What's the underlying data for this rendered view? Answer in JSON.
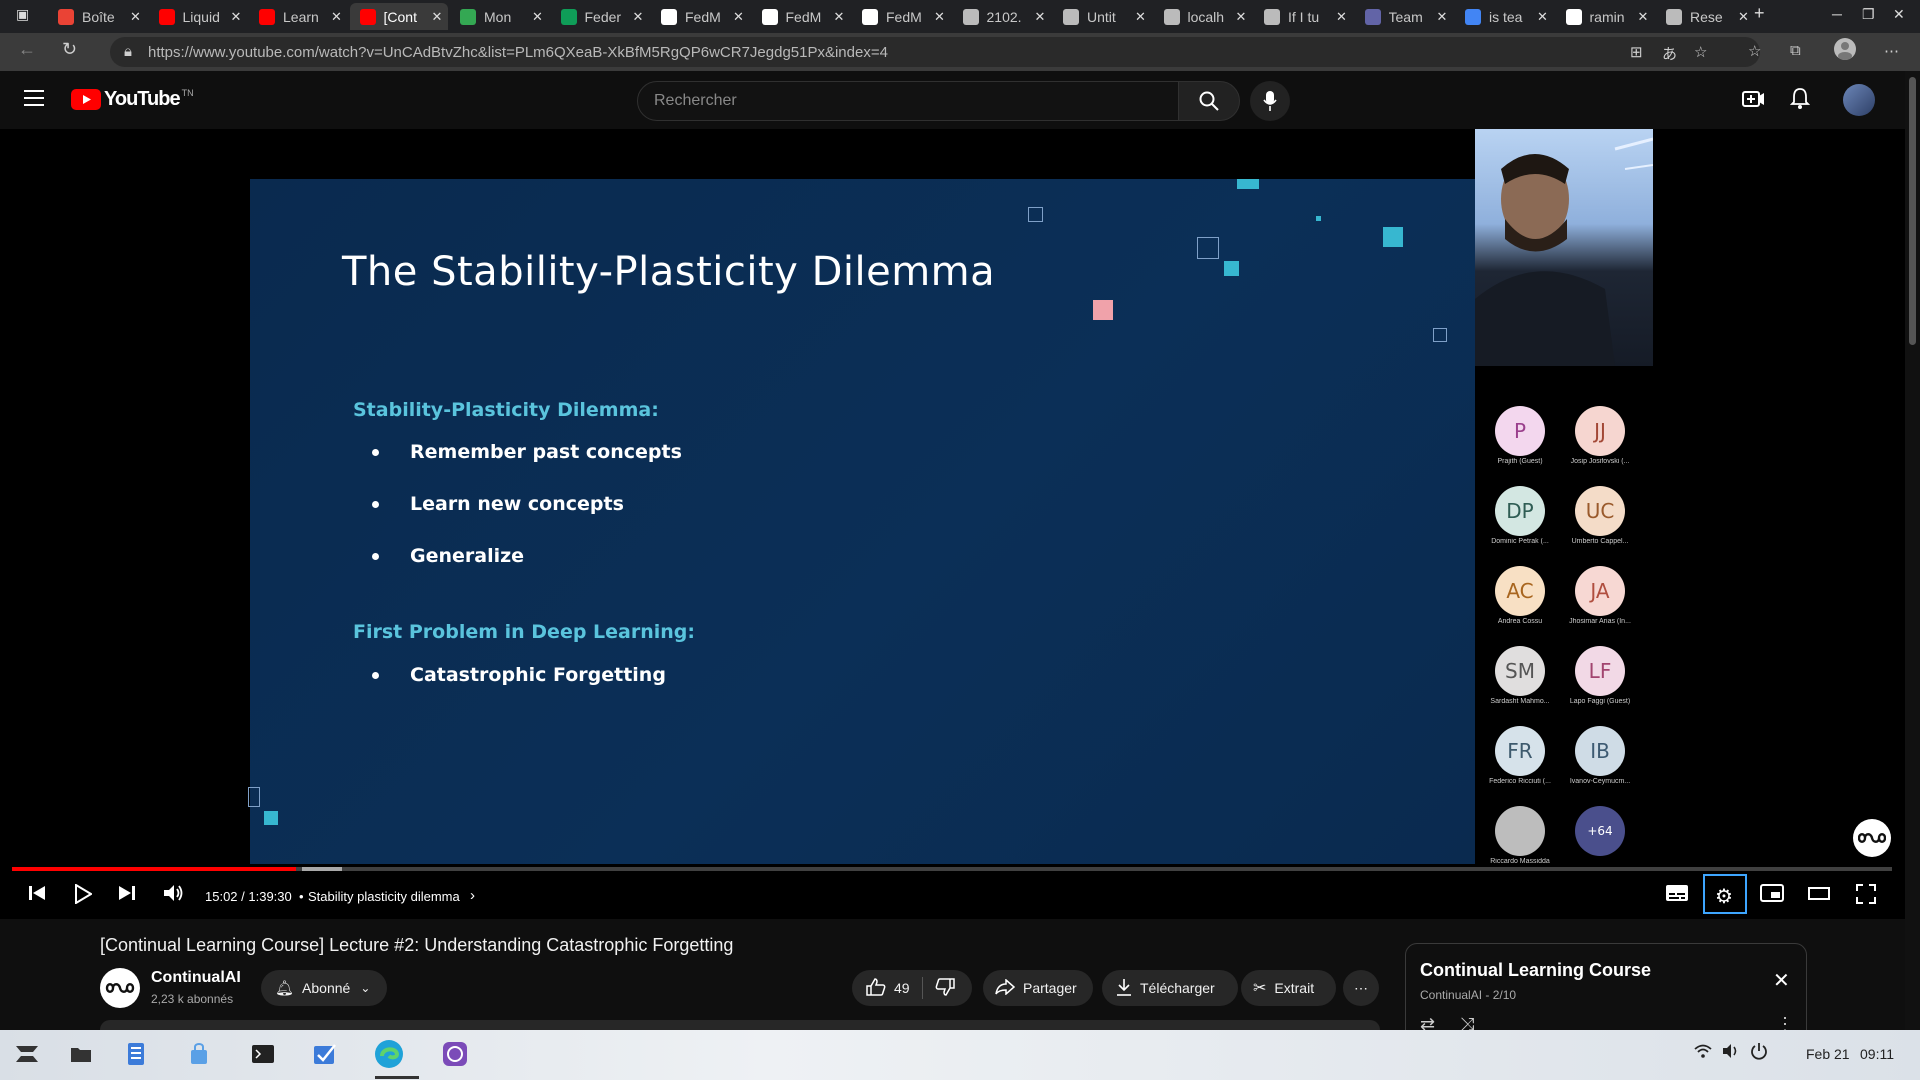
{
  "browser": {
    "tabs": [
      {
        "label": "Boîte",
        "icon": "gmail-icon",
        "color": "#ea4335"
      },
      {
        "label": "Liquid",
        "icon": "youtube-icon",
        "color": "#ff0000"
      },
      {
        "label": "Learn",
        "icon": "youtube-icon",
        "color": "#ff0000"
      },
      {
        "label": "[Cont",
        "icon": "youtube-icon",
        "color": "#ff0000",
        "active": true
      },
      {
        "label": "Mon",
        "icon": "drive-icon",
        "color": "#34a853"
      },
      {
        "label": "Feder",
        "icon": "sheets-icon",
        "color": "#0f9d58"
      },
      {
        "label": "FedM",
        "icon": "github-icon",
        "color": "#ffffff"
      },
      {
        "label": "FedM",
        "icon": "github-icon",
        "color": "#ffffff"
      },
      {
        "label": "FedM",
        "icon": "github-icon",
        "color": "#ffffff"
      },
      {
        "label": "2102.",
        "icon": "file-icon",
        "color": "#bbbbbb"
      },
      {
        "label": "Untit",
        "icon": "file-icon",
        "color": "#bbbbbb"
      },
      {
        "label": "localh",
        "icon": "lock-icon",
        "color": "#bbbbbb"
      },
      {
        "label": "If I tu",
        "icon": "file-icon",
        "color": "#bbbbbb"
      },
      {
        "label": "Team",
        "icon": "teams-icon",
        "color": "#6264a7"
      },
      {
        "label": "is tea",
        "icon": "google-icon",
        "color": "#4285f4"
      },
      {
        "label": "ramin",
        "icon": "github-icon",
        "color": "#ffffff"
      },
      {
        "label": "Rese",
        "icon": "file-icon",
        "color": "#bbbbbb"
      }
    ],
    "url": "https://www.youtube.com/watch?v=UnCAdBtvZhc&list=PLm6QXeaB-XkBfM5RgQP6wCR7Jegdg51Px&index=4"
  },
  "youtube": {
    "logo_text": "YouTube",
    "logo_suffix": "TN",
    "search_placeholder": "Rechercher"
  },
  "slide": {
    "title": "The Stability-Plasticity Dilemma",
    "section1": "Stability-Plasticity Dilemma:",
    "bullets1": [
      "Remember past concepts",
      "Learn new concepts",
      "Generalize"
    ],
    "section2": "First Problem in Deep Learning:",
    "bullets2": [
      "Catastrophic Forgetting"
    ]
  },
  "participants": [
    {
      "initials": "P",
      "name": "Prajith (Guest)",
      "bg": "#f3d7ee",
      "fg": "#9a3f8c"
    },
    {
      "initials": "JJ",
      "name": "Josip Josifovski (...",
      "bg": "#f6d6d0",
      "fg": "#a24735"
    },
    {
      "initials": "DP",
      "name": "Dominic Petrak (...",
      "bg": "#d3e7e2",
      "fg": "#2f5d54"
    },
    {
      "initials": "UC",
      "name": "Umberto Cappel...",
      "bg": "#f4dcc8",
      "fg": "#9a5a2c"
    },
    {
      "initials": "AC",
      "name": "Andrea Cossu",
      "bg": "#f8e0c4",
      "fg": "#a8651e"
    },
    {
      "initials": "JA",
      "name": "Jhosimar Arias (In...",
      "bg": "#f7d8d3",
      "fg": "#b04e3f"
    },
    {
      "initials": "SM",
      "name": "Sardasht Mahmo...",
      "bg": "#e0dede",
      "fg": "#555555"
    },
    {
      "initials": "LF",
      "name": "Lapo Faggi (Guest)",
      "bg": "#f2d9e6",
      "fg": "#a2456f"
    },
    {
      "initials": "FR",
      "name": "Federico Ricciuti (...",
      "bg": "#d6e2ea",
      "fg": "#3e5a6d"
    },
    {
      "initials": "IB",
      "name": "Ivanov-Ceymucm...",
      "bg": "#cfdce6",
      "fg": "#3d5a72"
    },
    {
      "initials": "",
      "name": "Riccardo Massidda",
      "bg": "#bdbdbd",
      "fg": "#333333"
    },
    {
      "initials": "+64",
      "name": "",
      "bg": "#4a4f8c",
      "fg": "#ffffff"
    }
  ],
  "player": {
    "time": "15:02 / 1:39:30",
    "chapter": "Stability plasticity dilemma",
    "progress": 0.151
  },
  "video": {
    "title": "[Continual Learning Course] Lecture #2: Understanding Catastrophic Forgetting",
    "channel": "ContinualAI",
    "subscribers": "2,23 k abonnés",
    "subscribed_label": "Abonné",
    "likes": "49",
    "share_label": "Partager",
    "download_label": "Télécharger",
    "clip_label": "Extrait"
  },
  "playlist": {
    "title": "Continual Learning Course",
    "subtitle": "ContinualAI - 2/10"
  },
  "taskbar": {
    "date": "Feb 21",
    "time": "09:11"
  }
}
